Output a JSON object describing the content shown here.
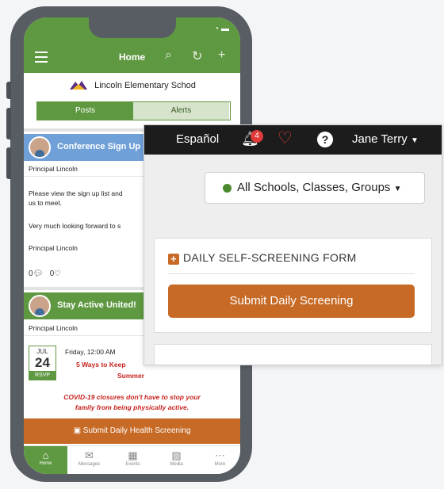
{
  "phone": {
    "topbar": {
      "title": "Home"
    },
    "school_name": "Lincoln Elementary Schod",
    "segments": [
      "Posts",
      "Alerts"
    ],
    "posts": [
      {
        "title": "Conference Sign Up",
        "author": "Principal Lincoln",
        "body1": "Please view the sign up list and",
        "body2": "us to meet.",
        "body3": "Very much looking forward to s",
        "signature": "Principal Lincoln",
        "comments": "0",
        "likes": "0"
      },
      {
        "title": "Stay Active United!",
        "author": "Principal Lincoln",
        "event": {
          "month": "JUL",
          "day": "24",
          "rsvp": "RSVP",
          "time": "Friday, 12:00 AM",
          "headline1": "5 Ways to Keep",
          "headline2": "Summer",
          "note1": "COVID-19 closures don't have to stop your",
          "note2": "family from being physically active."
        }
      }
    ],
    "screening_bar": "Submit Daily Health Screening",
    "tabs": [
      "Home",
      "Messages",
      "Events",
      "Media",
      "More"
    ]
  },
  "panel": {
    "nav": {
      "language": "Español",
      "notification_count": "4",
      "user_name": "Jane Terry"
    },
    "dropdown": {
      "label": "All Schools, Classes, Groups"
    },
    "form_card": {
      "title": "DAILY SELF-SCREENING FORM",
      "button": "Submit Daily Screening"
    }
  },
  "colors": {
    "brand_green": "#5e9840",
    "accent_orange": "#c66a26",
    "nav_dark": "#1c1c1c",
    "alert_red": "#e03a3a"
  }
}
